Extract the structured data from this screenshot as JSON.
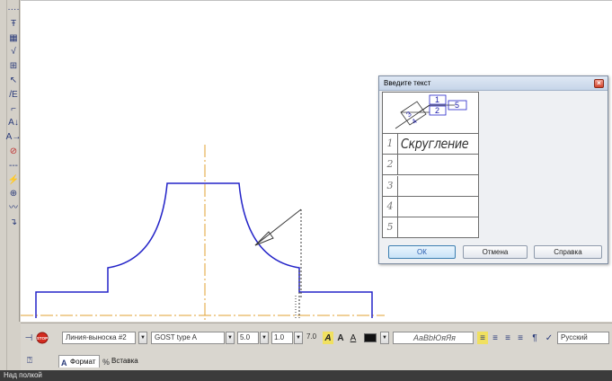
{
  "toolbar": {
    "tools": [
      {
        "name": "dots-icon",
        "glyph": "····"
      },
      {
        "name": "text-tool-icon",
        "glyph": "Ŧ"
      },
      {
        "name": "table-tool-icon",
        "glyph": "▦"
      },
      {
        "name": "roughness-tool-icon",
        "glyph": "√"
      },
      {
        "name": "datum-tool-icon",
        "glyph": "⊞"
      },
      {
        "name": "leader-tool-icon",
        "glyph": "↖"
      },
      {
        "name": "position-leader-icon",
        "glyph": "/E"
      },
      {
        "name": "brand-leader-icon",
        "glyph": "⌐"
      },
      {
        "name": "section-line-icon",
        "glyph": "A↓"
      },
      {
        "name": "view-arrow-icon",
        "glyph": "A→"
      },
      {
        "name": "local-view-icon",
        "glyph": "⊘"
      },
      {
        "name": "dash-line-icon",
        "glyph": "---"
      },
      {
        "name": "break-line-icon",
        "glyph": "⚡"
      },
      {
        "name": "center-mark-icon",
        "glyph": "⊕"
      },
      {
        "name": "wave-line-icon",
        "glyph": "〰"
      },
      {
        "name": "axis-line-icon",
        "glyph": "↴"
      }
    ]
  },
  "dialog": {
    "title": "Введите текст",
    "header_labels": {
      "n1": "1",
      "n2": "2",
      "n3": "3",
      "n4": "4",
      "n5": "5"
    },
    "rows": [
      {
        "num": "1",
        "text": "Скругление"
      },
      {
        "num": "2",
        "text": ""
      },
      {
        "num": "3",
        "text": ""
      },
      {
        "num": "4",
        "text": ""
      },
      {
        "num": "5",
        "text": ""
      }
    ],
    "ok_label": "ОК",
    "cancel_label": "Отмена",
    "help_label": "Справка"
  },
  "propbar": {
    "style_value": "Линия-выноска #2",
    "font_value": "GOST type A",
    "size_value": "5.0",
    "stretch_value": "1.0",
    "spacing_value": "7.0",
    "sample_text": "АаВbЮяЯя",
    "language_value": "Русский",
    "tabs": [
      {
        "label": "Формат"
      },
      {
        "label": "Вставка"
      }
    ],
    "stop_label": "STOP"
  },
  "status": {
    "text": "Над полкой"
  },
  "colors": {
    "geometry": "#2424c8",
    "axis": "#e0a030",
    "leader": "#3a3a3a"
  }
}
